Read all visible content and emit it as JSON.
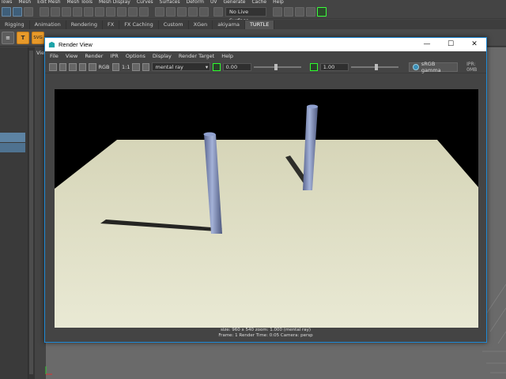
{
  "main_menu": [
    "lows",
    "Mesh",
    "Edit Mesh",
    "Mesh Tools",
    "Mesh Display",
    "Curves",
    "Surfaces",
    "Deform",
    "UV",
    "Generate",
    "Cache",
    "Help"
  ],
  "status_line": {
    "live_surface": "No Live Surface"
  },
  "shelf_tabs": [
    "Rigging",
    "Animation",
    "Rendering",
    "FX",
    "FX Caching",
    "Custom",
    "XGen",
    "akiyama",
    "TURTLE"
  ],
  "shelf_active_tab_index": 8,
  "shelf_buttons": {
    "t_label": "T",
    "svg_label": "SVG"
  },
  "panel": {
    "view_label": "Vie"
  },
  "render_view": {
    "title": "Render View",
    "menu": [
      "File",
      "View",
      "Render",
      "IPR",
      "Options",
      "Display",
      "Render Target",
      "Help"
    ],
    "toolbar": {
      "rgb_label": "RGB",
      "ratio_label": "1:1",
      "renderer": "mental ray",
      "exposure": "0.00",
      "gamma": "1.00",
      "color_mgmt": "sRGB gamma",
      "ipr_memory": "IPR: 0MB"
    },
    "info_line1": "size: 960 x 540  zoom: 1.000        (mental ray)",
    "info_line2": "Frame: 1        Render Time: 0:05         Camera: persp"
  },
  "colors": {
    "accent": "#1f8ad6",
    "toggle_green": "#2eff2e",
    "shelf_orange": "#e89a2a",
    "selection_blue": "#5d83a3",
    "ground": "#dcdcc2",
    "cylinder": "#7f8fb8"
  },
  "icons": [
    "select-tool-icon",
    "lasso-icon",
    "paint-select-icon",
    "snap-grid-icon",
    "snap-curve-icon",
    "snap-point-icon",
    "render-icon",
    "ipr-icon",
    "render-settings-icon",
    "close-icon",
    "maximize-icon",
    "minimize-icon",
    "maya-logo-icon"
  ]
}
